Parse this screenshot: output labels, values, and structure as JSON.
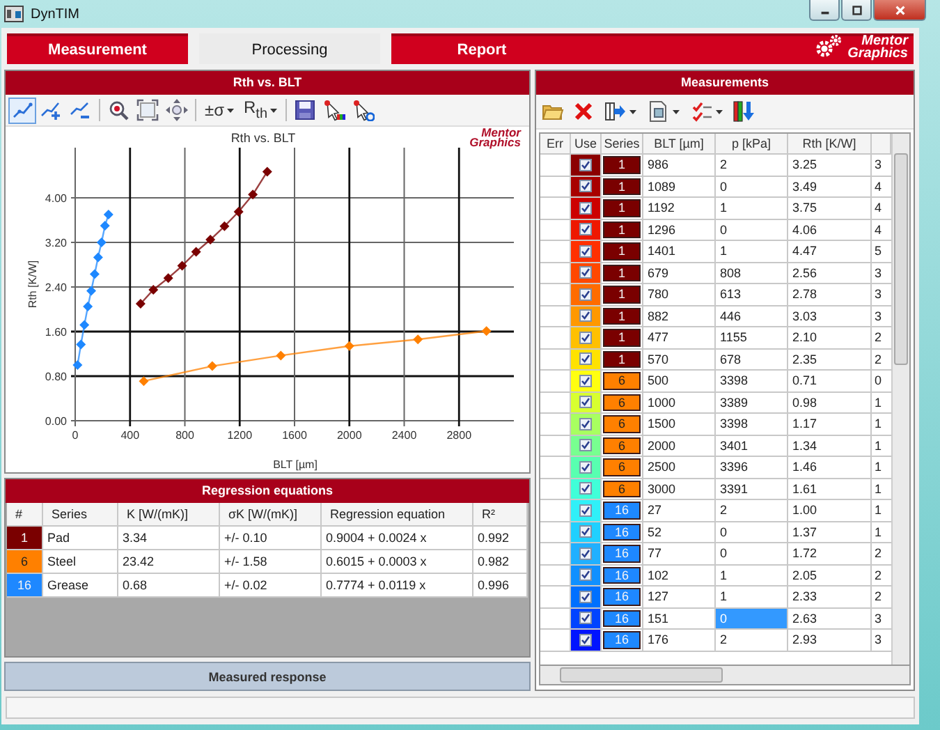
{
  "window": {
    "title": "DynTIM"
  },
  "tabs": [
    {
      "label": "Measurement",
      "selected": false
    },
    {
      "label": "Processing",
      "selected": true
    },
    {
      "label": "Report",
      "selected": false
    }
  ],
  "brand": {
    "line1": "Mentor",
    "line2": "Graphics"
  },
  "chart_panel": {
    "title": "Rth vs. BLT",
    "toolbar": [
      {
        "kind": "tool",
        "selected": true
      },
      {
        "kind": "tool",
        "selected": false
      },
      {
        "kind": "tool",
        "selected": false
      },
      {
        "kind": "separator"
      },
      {
        "kind": "tool",
        "selected": false
      },
      {
        "kind": "tool",
        "selected": false
      },
      {
        "kind": "tool",
        "selected": false
      },
      {
        "kind": "separator"
      },
      {
        "kind": "menu",
        "label": "±σ"
      },
      {
        "kind": "menu",
        "label": "R$_{th}$"
      },
      {
        "kind": "separator"
      },
      {
        "kind": "tool",
        "selected": false
      },
      {
        "kind": "tool",
        "selected": false
      },
      {
        "kind": "tool",
        "selected": false
      }
    ],
    "logo": {
      "line1": "Mentor",
      "line2": "Graphics"
    },
    "chart_data": {
      "type": "line",
      "grid": true,
      "title": "Rth vs. BLT",
      "xlabel": "BLT [µm]",
      "ylabel": "Rth [K/W]",
      "xlim": [
        0,
        3200
      ],
      "ylim": [
        0,
        4.9
      ],
      "xticks": [
        0,
        400,
        800,
        1200,
        1600,
        2000,
        2400,
        2800
      ],
      "yticks": [
        {
          "value": 0,
          "label": "0.00"
        },
        {
          "value": 0.8,
          "label": "0.80"
        },
        {
          "value": 1.6,
          "label": "1.60"
        },
        {
          "value": 2.4,
          "label": "2.40"
        },
        {
          "value": 3.2,
          "label": "3.20"
        },
        {
          "value": 4,
          "label": "4.00"
        }
      ],
      "series": [
        {
          "color": "#7a0000",
          "marker": "diamond",
          "x": [
            477,
            570,
            679,
            780,
            882,
            986,
            1089,
            1192,
            1296,
            1401
          ],
          "values": [
            2.1,
            2.35,
            2.56,
            2.78,
            3.03,
            3.25,
            3.49,
            3.75,
            4.06,
            4.47
          ]
        },
        {
          "color": "#ff8000",
          "marker": "diamond",
          "x": [
            500,
            1000,
            1500,
            2000,
            2500,
            3000
          ],
          "values": [
            0.71,
            0.98,
            1.17,
            1.34,
            1.46,
            1.61
          ]
        },
        {
          "color": "#1e88ff",
          "marker": "diamond",
          "x": [
            17,
            42,
            67,
            92,
            117,
            142,
            167,
            192,
            217,
            243
          ],
          "values": [
            1.0,
            1.37,
            1.72,
            2.05,
            2.33,
            2.63,
            2.93,
            3.2,
            3.5,
            3.7
          ]
        }
      ]
    }
  },
  "regression": {
    "title": "Regression equations",
    "columns": [
      "#",
      "Series",
      "K [W/(mK)]",
      "σK [W/(mK)]",
      "Regression equation",
      "R²"
    ],
    "rows": [
      {
        "number": "1",
        "color": "#7a0000",
        "series": "Pad",
        "k": "3.34",
        "sigma_k": "+/- 0.10",
        "equation": "0.9004 + 0.0024 x",
        "r2": "0.992"
      },
      {
        "number": "6",
        "color": "#ff8000",
        "series": "Steel",
        "k": "23.42",
        "sigma_k": "+/- 1.58",
        "equation": "0.6015 + 0.0003 x",
        "r2": "0.982"
      },
      {
        "number": "16",
        "color": "#1e88ff",
        "series": "Grease",
        "k": "0.68",
        "sigma_k": "+/- 0.02",
        "equation": "0.7774 + 0.0119 x",
        "r2": "0.996"
      }
    ]
  },
  "measured_response": {
    "title": "Measured response"
  },
  "measurements": {
    "title": "Measurements",
    "toolbar": [
      {
        "kind": "tool"
      },
      {
        "kind": "tool"
      },
      {
        "kind": "menu"
      },
      {
        "kind": "menu"
      },
      {
        "kind": "menu"
      },
      {
        "kind": "tool"
      }
    ],
    "columns": [
      "Err",
      "Use",
      "Series",
      "BLT [µm]",
      "p [kPa]",
      "Rth [K/W]"
    ],
    "rows": [
      {
        "use": true,
        "color": "#8b0000",
        "series": {
          "label": "1",
          "color": "#7a0000"
        },
        "blt": "986",
        "p": "2",
        "rth": "3.25",
        "column_7": "3",
        "selected": false
      },
      {
        "use": true,
        "color": "#a80000",
        "series": {
          "label": "1",
          "color": "#7a0000"
        },
        "blt": "1089",
        "p": "0",
        "rth": "3.49",
        "column_7": "4",
        "selected": false
      },
      {
        "use": true,
        "color": "#cc0000",
        "series": {
          "label": "1",
          "color": "#7a0000"
        },
        "blt": "1192",
        "p": "1",
        "rth": "3.75",
        "column_7": "4",
        "selected": false
      },
      {
        "use": true,
        "color": "#ee1800",
        "series": {
          "label": "1",
          "color": "#7a0000"
        },
        "blt": "1296",
        "p": "0",
        "rth": "4.06",
        "column_7": "4",
        "selected": false
      },
      {
        "use": true,
        "color": "#ff3000",
        "series": {
          "label": "1",
          "color": "#7a0000"
        },
        "blt": "1401",
        "p": "1",
        "rth": "4.47",
        "column_7": "5",
        "selected": false
      },
      {
        "use": true,
        "color": "#ff4800",
        "series": {
          "label": "1",
          "color": "#7a0000"
        },
        "blt": "679",
        "p": "808",
        "rth": "2.56",
        "column_7": "3",
        "selected": false
      },
      {
        "use": true,
        "color": "#ff6c00",
        "series": {
          "label": "1",
          "color": "#7a0000"
        },
        "blt": "780",
        "p": "613",
        "rth": "2.78",
        "column_7": "3",
        "selected": false
      },
      {
        "use": true,
        "color": "#ff9800",
        "series": {
          "label": "1",
          "color": "#7a0000"
        },
        "blt": "882",
        "p": "446",
        "rth": "3.03",
        "column_7": "3",
        "selected": false
      },
      {
        "use": true,
        "color": "#ffc000",
        "series": {
          "label": "1",
          "color": "#7a0000"
        },
        "blt": "477",
        "p": "1155",
        "rth": "2.10",
        "column_7": "2",
        "selected": false
      },
      {
        "use": true,
        "color": "#ffe200",
        "series": {
          "label": "1",
          "color": "#7a0000"
        },
        "blt": "570",
        "p": "678",
        "rth": "2.35",
        "column_7": "2",
        "selected": false
      },
      {
        "use": true,
        "color": "#ffff10",
        "series": {
          "label": "6",
          "color": "#ff8000"
        },
        "blt": "500",
        "p": "3398",
        "rth": "0.71",
        "column_7": "0",
        "selected": false
      },
      {
        "use": true,
        "color": "#d8ff30",
        "series": {
          "label": "6",
          "color": "#ff8000"
        },
        "blt": "1000",
        "p": "3389",
        "rth": "0.98",
        "column_7": "1",
        "selected": false
      },
      {
        "use": true,
        "color": "#a8ff60",
        "series": {
          "label": "6",
          "color": "#ff8000"
        },
        "blt": "1500",
        "p": "3398",
        "rth": "1.17",
        "column_7": "1",
        "selected": false
      },
      {
        "use": true,
        "color": "#78ff90",
        "series": {
          "label": "6",
          "color": "#ff8000"
        },
        "blt": "2000",
        "p": "3401",
        "rth": "1.34",
        "column_7": "1",
        "selected": false
      },
      {
        "use": true,
        "color": "#58ffb0",
        "series": {
          "label": "6",
          "color": "#ff8000"
        },
        "blt": "2500",
        "p": "3396",
        "rth": "1.46",
        "column_7": "1",
        "selected": false
      },
      {
        "use": true,
        "color": "#40ffd8",
        "series": {
          "label": "6",
          "color": "#ff8000"
        },
        "blt": "3000",
        "p": "3391",
        "rth": "1.61",
        "column_7": "1",
        "selected": false
      },
      {
        "use": true,
        "color": "#30f0f8",
        "series": {
          "label": "16",
          "color": "#1e88ff"
        },
        "blt": "27",
        "p": "2",
        "rth": "1.00",
        "column_7": "1",
        "selected": false
      },
      {
        "use": true,
        "color": "#20d0ff",
        "series": {
          "label": "16",
          "color": "#1e88ff"
        },
        "blt": "52",
        "p": "0",
        "rth": "1.37",
        "column_7": "1",
        "selected": false
      },
      {
        "use": true,
        "color": "#20b0ff",
        "series": {
          "label": "16",
          "color": "#1e88ff"
        },
        "blt": "77",
        "p": "0",
        "rth": "1.72",
        "column_7": "2",
        "selected": false
      },
      {
        "use": true,
        "color": "#1090ff",
        "series": {
          "label": "16",
          "color": "#1e88ff"
        },
        "blt": "102",
        "p": "1",
        "rth": "2.05",
        "column_7": "2",
        "selected": false
      },
      {
        "use": true,
        "color": "#0070ff",
        "series": {
          "label": "16",
          "color": "#1e88ff"
        },
        "blt": "127",
        "p": "1",
        "rth": "2.33",
        "column_7": "2",
        "selected": false
      },
      {
        "use": true,
        "color": "#0044ff",
        "series": {
          "label": "16",
          "color": "#1e88ff"
        },
        "blt": "151",
        "p": "0",
        "rth": "2.63",
        "column_7": "3",
        "selected": true
      },
      {
        "use": true,
        "color": "#0014ff",
        "series": {
          "label": "16",
          "color": "#1e88ff"
        },
        "blt": "176",
        "p": "2",
        "rth": "2.93",
        "column_7": "3",
        "selected": false
      }
    ]
  }
}
